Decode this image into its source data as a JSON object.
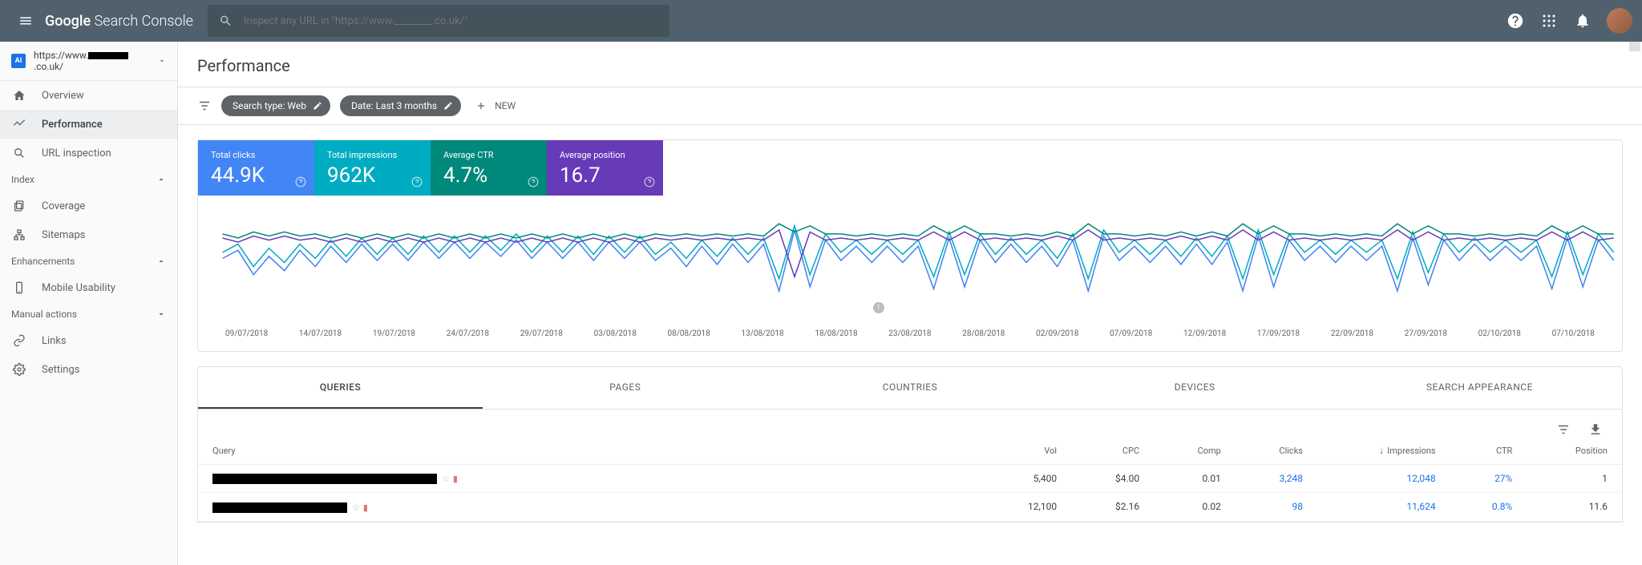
{
  "logo_brand": "Google",
  "logo_product": "Search Console",
  "search": {
    "placeholder": "Inspect any URL in \"https://www.________.co.uk/\""
  },
  "property": {
    "prefix": "https://www.",
    "suffix": ".co.uk/"
  },
  "sidebar": {
    "items": [
      {
        "label": "Overview"
      },
      {
        "label": "Performance"
      },
      {
        "label": "URL inspection"
      }
    ],
    "index": {
      "label": "Index",
      "items": [
        {
          "label": "Coverage"
        },
        {
          "label": "Sitemaps"
        }
      ]
    },
    "enhancements": {
      "label": "Enhancements",
      "items": [
        {
          "label": "Mobile Usability"
        }
      ]
    },
    "manual": {
      "label": "Manual actions"
    },
    "bottom": [
      {
        "label": "Links"
      },
      {
        "label": "Settings"
      }
    ]
  },
  "page_title": "Performance",
  "filters": {
    "type": "Search type: Web",
    "date": "Date: Last 3 months",
    "new": "NEW"
  },
  "metrics": [
    {
      "label": "Total clicks",
      "value": "44.9K"
    },
    {
      "label": "Total impressions",
      "value": "962K"
    },
    {
      "label": "Average CTR",
      "value": "4.7%"
    },
    {
      "label": "Average position",
      "value": "16.7"
    }
  ],
  "chart_data": {
    "type": "line",
    "x_labels": [
      "09/07/2018",
      "14/07/2018",
      "19/07/2018",
      "24/07/2018",
      "29/07/2018",
      "03/08/2018",
      "08/08/2018",
      "13/08/2018",
      "18/08/2018",
      "23/08/2018",
      "28/08/2018",
      "02/09/2018",
      "07/09/2018",
      "12/09/2018",
      "17/09/2018",
      "22/09/2018",
      "27/09/2018",
      "02/10/2018",
      "07/10/2018"
    ],
    "series": [
      {
        "name": "Total clicks",
        "color": "#4285f4",
        "values": [
          46,
          38,
          62,
          44,
          58,
          38,
          54,
          34,
          50,
          32,
          48,
          32,
          48,
          30,
          46,
          30,
          46,
          30,
          44,
          28,
          46,
          30,
          46,
          30,
          48,
          30,
          46,
          30,
          48,
          36,
          54,
          34,
          52,
          32,
          50,
          32,
          78,
          18,
          74,
          28,
          48,
          34,
          50,
          34,
          50,
          34,
          76,
          26,
          74,
          28,
          50,
          32,
          50,
          34,
          54,
          28,
          78,
          24,
          48,
          34,
          50,
          34,
          52,
          32,
          52,
          30,
          78,
          24,
          74,
          28,
          48,
          34,
          50,
          34,
          48,
          34,
          78,
          26,
          72,
          28,
          48,
          32,
          48,
          34,
          48,
          34,
          76,
          26,
          74,
          28,
          48
        ]
      },
      {
        "name": "Total impressions",
        "color": "#00acc1",
        "values": [
          40,
          32,
          54,
          36,
          50,
          32,
          46,
          28,
          44,
          26,
          42,
          26,
          42,
          24,
          40,
          24,
          40,
          24,
          38,
          22,
          40,
          24,
          40,
          24,
          42,
          24,
          40,
          24,
          42,
          30,
          46,
          28,
          44,
          26,
          42,
          26,
          66,
          14,
          62,
          22,
          40,
          28,
          42,
          28,
          42,
          28,
          64,
          20,
          62,
          22,
          42,
          26,
          42,
          28,
          46,
          22,
          66,
          18,
          40,
          28,
          42,
          28,
          44,
          26,
          44,
          24,
          66,
          18,
          62,
          22,
          40,
          28,
          42,
          28,
          40,
          28,
          66,
          20,
          60,
          22,
          40,
          26,
          40,
          28,
          40,
          28,
          64,
          20,
          62,
          22,
          40
        ]
      },
      {
        "name": "Average CTR",
        "color": "#00897b",
        "values": [
          22,
          26,
          20,
          24,
          20,
          24,
          22,
          26,
          22,
          26,
          22,
          26,
          22,
          26,
          22,
          26,
          22,
          26,
          22,
          26,
          22,
          26,
          22,
          26,
          22,
          26,
          22,
          26,
          22,
          24,
          22,
          24,
          22,
          24,
          22,
          24,
          12,
          20,
          14,
          22,
          22,
          24,
          22,
          24,
          22,
          24,
          14,
          22,
          14,
          22,
          22,
          24,
          22,
          24,
          20,
          24,
          12,
          22,
          22,
          24,
          22,
          24,
          20,
          24,
          20,
          24,
          12,
          22,
          14,
          22,
          22,
          24,
          22,
          24,
          22,
          24,
          12,
          22,
          14,
          22,
          22,
          24,
          22,
          24,
          22,
          24,
          14,
          22,
          14,
          22,
          22
        ]
      },
      {
        "name": "Average position",
        "color": "#673ab7",
        "values": [
          26,
          30,
          24,
          28,
          24,
          28,
          26,
          30,
          26,
          30,
          26,
          30,
          26,
          30,
          26,
          30,
          26,
          30,
          26,
          30,
          26,
          30,
          26,
          30,
          26,
          30,
          26,
          30,
          26,
          28,
          26,
          28,
          26,
          28,
          26,
          28,
          18,
          64,
          20,
          28,
          26,
          28,
          26,
          28,
          26,
          28,
          20,
          28,
          20,
          28,
          26,
          28,
          26,
          28,
          24,
          28,
          18,
          28,
          26,
          28,
          26,
          28,
          24,
          28,
          24,
          28,
          18,
          28,
          20,
          28,
          26,
          28,
          26,
          28,
          26,
          28,
          18,
          28,
          20,
          28,
          26,
          28,
          26,
          28,
          26,
          28,
          20,
          28,
          20,
          28,
          26
        ]
      }
    ]
  },
  "tabs": [
    "QUERIES",
    "PAGES",
    "COUNTRIES",
    "DEVICES",
    "SEARCH APPEARANCE"
  ],
  "table": {
    "columns": [
      "Query",
      "Vol",
      "CPC",
      "Comp",
      "Clicks",
      "Impressions",
      "CTR",
      "Position"
    ],
    "sort_col": "Impressions",
    "rows": [
      {
        "redact_w": 280,
        "vol": "5,400",
        "cpc": "$4.00",
        "comp": "0.01",
        "clicks": "3,248",
        "impressions": "12,048",
        "ctr": "27%",
        "position": "1"
      },
      {
        "redact_w": 168,
        "vol": "12,100",
        "cpc": "$2.16",
        "comp": "0.02",
        "clicks": "98",
        "impressions": "11,624",
        "ctr": "0.8%",
        "position": "11.6"
      }
    ]
  }
}
